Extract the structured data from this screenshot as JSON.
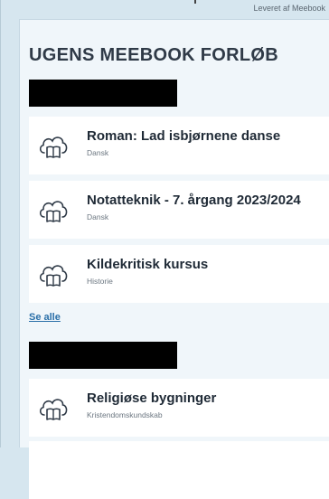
{
  "credit": "Leveret af Meebook",
  "heading": "UGENS MEEBOOK FORLØB",
  "courses_week": [
    {
      "title": "Roman: Lad isbjørnene danse",
      "subject": "Dansk",
      "icon": "cloud-book-icon"
    },
    {
      "title": "Notatteknik - 7. årgang 2023/2024",
      "subject": "Dansk",
      "icon": "cloud-book-icon"
    },
    {
      "title": "Kildekritisk kursus",
      "subject": "Historie",
      "icon": "cloud-book-icon"
    }
  ],
  "see_all_label": "Se alle",
  "courses_second": [
    {
      "title": "Religiøse bygninger",
      "subject": "Kristendomskundskab",
      "icon": "cloud-book-icon"
    }
  ],
  "colors": {
    "background": "#d6e6ef",
    "panel": "#f0f6fa",
    "card": "#ffffff",
    "heading": "#2f3a47",
    "link": "#2a6fa8"
  }
}
